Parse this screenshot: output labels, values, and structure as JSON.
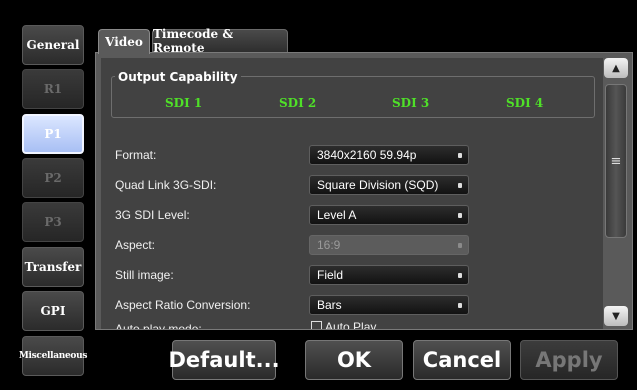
{
  "sidebar": {
    "items": [
      {
        "label": "General"
      },
      {
        "label": "R1"
      },
      {
        "label": "P1"
      },
      {
        "label": "P2"
      },
      {
        "label": "P3"
      },
      {
        "label": "Transfer"
      },
      {
        "label": "GPI"
      },
      {
        "label": "Miscellaneous"
      }
    ]
  },
  "tabs": [
    {
      "label": "Video"
    },
    {
      "label": "Timecode & Remote"
    }
  ],
  "output_capability": {
    "title": "Output Capability",
    "channels": [
      "SDI 1",
      "SDI 2",
      "SDI 3",
      "SDI 4"
    ]
  },
  "settings": [
    {
      "label": "Format:",
      "value": "3840x2160 59.94p"
    },
    {
      "label": "Quad Link 3G-SDI:",
      "value": "Square Division (SQD)"
    },
    {
      "label": "3G SDI Level:",
      "value": "Level A"
    },
    {
      "label": "Aspect:",
      "value": "16:9"
    },
    {
      "label": "Still image:",
      "value": "Field"
    },
    {
      "label": "Aspect Ratio Conversion:",
      "value": "Bars"
    },
    {
      "label": "Auto play mode:",
      "checkbox_label": "Auto Play"
    }
  ],
  "scrollbar": {
    "thumb_icon": "grip-lines-icon",
    "up_icon": "triangle-up-icon",
    "down_icon": "triangle-down-icon"
  },
  "buttons": {
    "default": "Default...",
    "ok": "OK",
    "cancel": "Cancel",
    "apply": "Apply"
  },
  "colors": {
    "sdi_green": "#4fe028",
    "active_sidebar": "#b8ccf8",
    "background": "#000000"
  }
}
